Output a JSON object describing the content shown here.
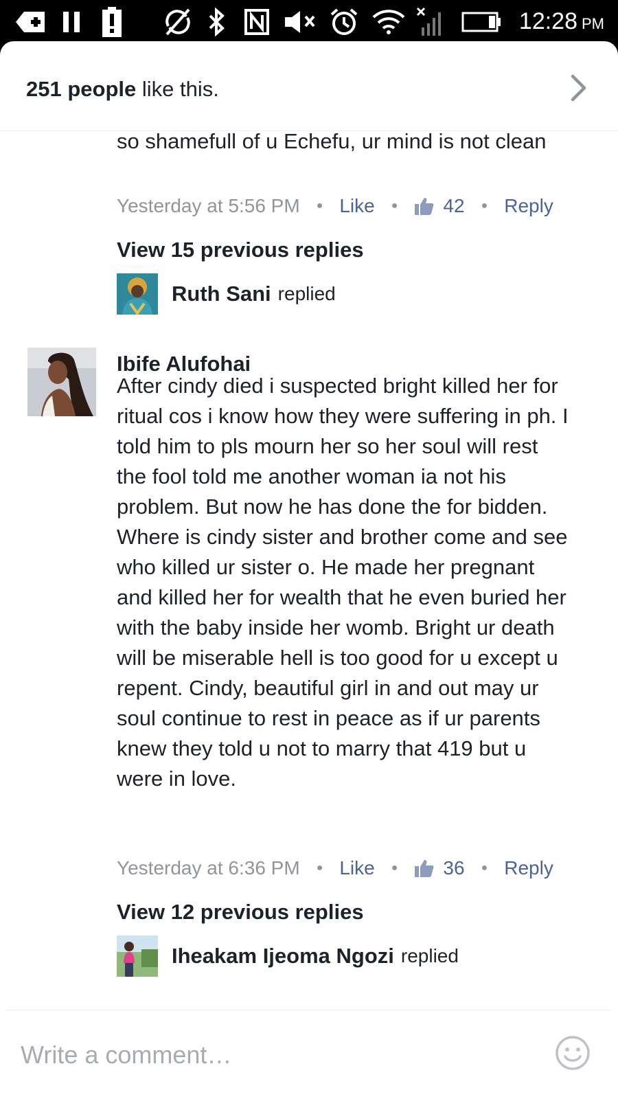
{
  "status_bar": {
    "time": "12:28",
    "ampm": "PM"
  },
  "likes_header": {
    "count_label": "251 people",
    "suffix": " like this."
  },
  "comments": [
    {
      "text": "so shamefull of u Echefu, ur mind is not clean",
      "timestamp": "Yesterday at 5:56 PM",
      "like_label": "Like",
      "like_count": "42",
      "reply_label": "Reply",
      "view_previous": "View 15 previous replies",
      "last_reply": {
        "name": "Ruth Sani",
        "verb": "replied"
      }
    },
    {
      "author": "Ibife Alufohai",
      "text": "After cindy died i suspected bright killed her for ritual cos i know how they were suffering in ph. I told him to pls mourn her so her soul will rest the fool told me another woman ia not his problem. But now he has done the for bidden. Where is cindy sister and brother come and see who killed ur sister o. He made her pregnant and killed her for wealth that he even buried her with the baby inside her womb. Bright ur death will be miserable hell is too good for u except u repent. Cindy, beautiful girl in and out may ur soul continue to rest in peace as if ur parents knew they told u not to marry that 419 but u were in love.",
      "timestamp": "Yesterday at 6:36 PM",
      "like_label": "Like",
      "like_count": "36",
      "reply_label": "Reply",
      "view_previous": "View 12 previous replies",
      "last_reply": {
        "name": "Iheakam Ijeoma Ngozi",
        "verb": "replied"
      }
    }
  ],
  "composer": {
    "placeholder": "Write a comment…"
  },
  "colors": {
    "link": "#4b6496",
    "meta_gray": "#90949c",
    "text": "#1d2129"
  }
}
